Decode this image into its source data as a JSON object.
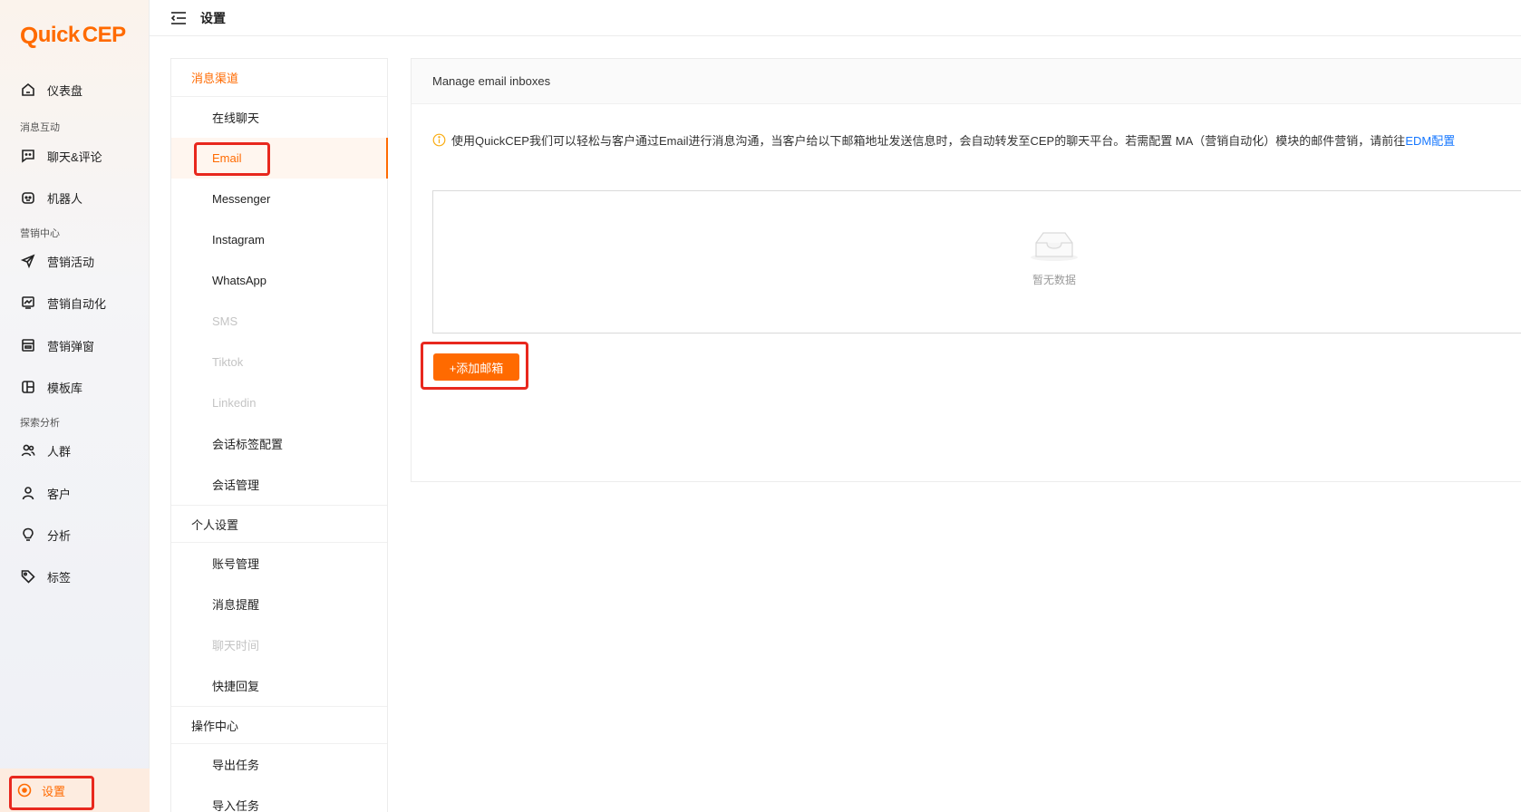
{
  "brand": {
    "logo_q": "Q",
    "logo_mid": "uick",
    "logo_cep": "CEP",
    "accent": "#ff6a00"
  },
  "sidebar": {
    "items": [
      {
        "label": "仪表盘",
        "icon": "home-icon"
      },
      {
        "group": "消息互动"
      },
      {
        "label": "聊天&评论",
        "icon": "chat-icon"
      },
      {
        "label": "机器人",
        "icon": "robot-icon"
      },
      {
        "group": "营销中心"
      },
      {
        "label": "营销活动",
        "icon": "send-icon"
      },
      {
        "label": "营销自动化",
        "icon": "automation-icon"
      },
      {
        "label": "营销弹窗",
        "icon": "popup-icon"
      },
      {
        "label": "模板库",
        "icon": "template-icon"
      },
      {
        "group": "探索分析"
      },
      {
        "label": "人群",
        "icon": "users-icon"
      },
      {
        "label": "客户",
        "icon": "user-icon"
      },
      {
        "label": "分析",
        "icon": "bulb-icon"
      },
      {
        "label": "标签",
        "icon": "tag-icon"
      }
    ],
    "settings_label": "设置"
  },
  "header": {
    "title": "设置"
  },
  "submenu": {
    "groups": [
      {
        "title": "消息渠道",
        "items": [
          {
            "label": "在线聊天",
            "state": "normal"
          },
          {
            "label": "Email",
            "state": "active"
          },
          {
            "label": "Messenger",
            "state": "normal"
          },
          {
            "label": "Instagram",
            "state": "normal"
          },
          {
            "label": "WhatsApp",
            "state": "normal"
          },
          {
            "label": "SMS",
            "state": "disabled"
          },
          {
            "label": "Tiktok",
            "state": "disabled"
          },
          {
            "label": "Linkedin",
            "state": "disabled"
          },
          {
            "label": "会话标签配置",
            "state": "normal"
          },
          {
            "label": "会话管理",
            "state": "normal"
          }
        ]
      },
      {
        "title": "个人设置",
        "items": [
          {
            "label": "账号管理",
            "state": "normal"
          },
          {
            "label": "消息提醒",
            "state": "normal"
          },
          {
            "label": "聊天时间",
            "state": "disabled"
          },
          {
            "label": "快捷回复",
            "state": "normal"
          }
        ]
      },
      {
        "title": "操作中心",
        "items": [
          {
            "label": "导出任务",
            "state": "normal"
          },
          {
            "label": "导入任务",
            "state": "normal"
          }
        ]
      }
    ]
  },
  "main": {
    "panel_title": "Manage email inboxes",
    "info_text": "使用QuickCEP我们可以轻松与客户通过Email进行消息沟通，当客户给以下邮箱地址发送信息时，会自动转发至CEP的聊天平台。若需配置 MA（营销自动化）模块的邮件营销，请前往",
    "info_link": "EDM配置",
    "empty_text": "暂无数据",
    "add_button": "+添加邮箱"
  }
}
